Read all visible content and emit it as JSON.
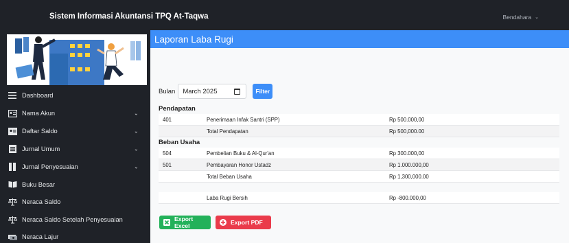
{
  "app": {
    "title": "Sistem Informasi Akuntansi TPQ At-Taqwa"
  },
  "user": {
    "name": "Bendahara",
    "menu_icon": "chevron-down-icon"
  },
  "colors": {
    "sidebar_bg": "#1f2228",
    "accent": "#3d8ef8",
    "excel": "#23b15a",
    "pdf": "#ea3b4b"
  },
  "sidebar": {
    "items": [
      {
        "label": "Dashboard",
        "icon": "hamburger-icon",
        "has_submenu": false
      },
      {
        "label": "Nama Akun",
        "icon": "id-card-icon",
        "has_submenu": true
      },
      {
        "label": "Daftar Saldo",
        "icon": "address-card-icon",
        "has_submenu": true
      },
      {
        "label": "Jurnal Umum",
        "icon": "list-document-icon",
        "has_submenu": true
      },
      {
        "label": "Jurnal Penyesuaian",
        "icon": "columns-icon",
        "has_submenu": true
      },
      {
        "label": "Buku Besar",
        "icon": "open-book-icon",
        "has_submenu": false
      },
      {
        "label": "Neraca Saldo",
        "icon": "scale-icon",
        "has_submenu": false
      },
      {
        "label": "Neraca Saldo Setelah Penyesuaian",
        "icon": "scale-icon",
        "has_submenu": false
      },
      {
        "label": "Neraca Lajur",
        "icon": "money-icon",
        "has_submenu": false
      }
    ]
  },
  "page": {
    "title": "Laporan Laba Rugi"
  },
  "filter": {
    "label": "Bulan",
    "month_value": "March 2025",
    "button_label": "Filter"
  },
  "report": {
    "pendapatan": {
      "title": "Pendapatan",
      "rows": [
        {
          "code": "401",
          "name": "Penerimaan Infak Santri (SPP)",
          "amount": "Rp 500.000,00"
        },
        {
          "code": "",
          "name": "Total Pendapatan",
          "amount": "Rp 500,000.00"
        }
      ]
    },
    "beban": {
      "title": "Beban Usaha",
      "rows": [
        {
          "code": "504",
          "name": "Pembelian Buku & Al-Qur'an",
          "amount": "Rp 300.000,00"
        },
        {
          "code": "501",
          "name": "Pembayaran Honor Ustadz",
          "amount": "Rp 1.000.000,00"
        },
        {
          "code": "",
          "name": "Total Beban Usaha",
          "amount": "Rp 1,300,000.00"
        }
      ]
    },
    "laba": {
      "code": "",
      "name": "Laba Rugi Bersih",
      "amount": "Rp -800.000,00"
    }
  },
  "actions": {
    "excel_label": "Export Excel",
    "pdf_label": "Export PDF"
  }
}
